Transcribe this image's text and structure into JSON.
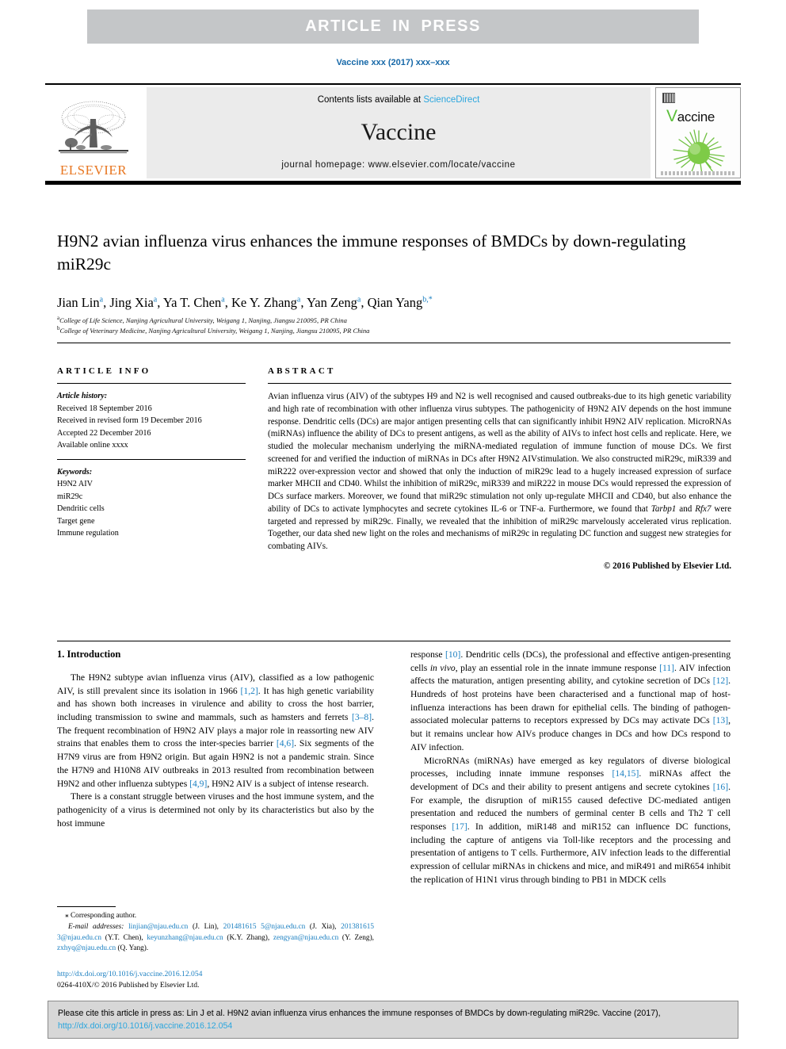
{
  "banner": {
    "text": "ARTICLE IN PRESS"
  },
  "running_head": "Vaccine xxx (2017) xxx–xxx",
  "masthead": {
    "publisher_name": "ELSEVIER",
    "contents_prefix": "Contents lists available at ",
    "contents_link": "ScienceDirect",
    "journal_name": "Vaccine",
    "homepage": "journal homepage: www.elsevier.com/locate/vaccine",
    "cover_title_first": "V",
    "cover_title_rest": "accine"
  },
  "article": {
    "title": "H9N2 avian influenza virus enhances the immune responses of BMDCs by down-regulating miR29c",
    "authors_html": "Jian Lin<sup>a</sup>, Jing Xia<sup>a</sup>, Ya T. Chen<sup>a</sup>, Ke Y. Zhang<sup>a</sup>, Yan Zeng<sup>a</sup>, Qian Yang<sup>b,*</sup>",
    "affiliation_a": "College of Life Science, Nanjing Agricultural University, Weigang 1, Nanjing, Jiangsu 210095, PR China",
    "affiliation_b": "College of Veterinary Medicine, Nanjing Agricultural University, Weigang 1, Nanjing, Jiangsu 210095, PR China"
  },
  "article_info": {
    "heading": "ARTICLE INFO",
    "history_label": "Article history:",
    "history": [
      "Received 18 September 2016",
      "Received in revised form 19 December 2016",
      "Accepted 22 December 2016",
      "Available online xxxx"
    ],
    "keywords_label": "Keywords:",
    "keywords": [
      "H9N2 AIV",
      "miR29c",
      "Dendritic cells",
      "Target gene",
      "Immune regulation"
    ]
  },
  "abstract": {
    "heading": "ABSTRACT",
    "body_html": "Avian influenza virus (AIV) of the subtypes H9 and N2 is well recognised and caused outbreaks-due to its high genetic variability and high rate of recombination with other influenza virus subtypes. The pathogenicity of H9N2 AIV depends on the host immune response. Dendritic cells (DCs) are major antigen presenting cells that can significantly inhibit H9N2 AIV replication. MicroRNAs (miRNAs) influence the ability of DCs to present antigens, as well as the ability of AIVs to infect host cells and replicate. Here, we studied the molecular mechanism underlying the miRNA-mediated regulation of immune function of mouse DCs. We first screened for and verified the induction of miRNAs in DCs after H9N2 AIVstimulation. We also constructed miR29c, miR339 and miR222 over-expression vector and showed that only the induction of miR29c lead to a hugely increased expression of surface marker MHCII and CD40. Whilst the inhibition of miR29c, miR339 and miR222 in mouse DCs would repressed the expression of DCs surface markers. Moreover, we found that miR29c stimulation not only up-regulate MHCII and CD40, but also enhance the ability of DCs to activate lymphocytes and secrete cytokines IL-6 or TNF-a. Furthermore, we found that <span class=\"gene\">Tarbp1</span> and <span class=\"gene\">Rfx7</span> were targeted and repressed by miR29c. Finally, we revealed that the inhibition of miR29c marvelously accelerated virus replication. Together, our data shed new light on the roles and mechanisms of miR29c in regulating DC function and suggest new strategies for combating AIVs.",
    "copyright": "© 2016 Published by Elsevier Ltd."
  },
  "introduction": {
    "heading": "1. Introduction",
    "left_paragraphs_html": [
      "The H9N2 subtype avian influenza virus (AIV), classified as a low pathogenic AIV, is still prevalent since its isolation in 1966 <span class=\"ref\">[1,2]</span>. It has high genetic variability and has shown both increases in virulence and ability to cross the host barrier, including transmission to swine and mammals, such as hamsters and ferrets <span class=\"ref\">[3–8]</span>. The frequent recombination of H9N2 AIV plays a major role in reassorting new AIV strains that enables them to cross the inter-species barrier <span class=\"ref\">[4,6]</span>. Six segments of the H7N9 virus are from H9N2 origin. But again H9N2 is not a pandemic strain. Since the H7N9 and H10N8 AIV outbreaks in 2013 resulted from recombination between H9N2 and other influenza subtypes <span class=\"ref\">[4,9]</span>, H9N2 AIV is a subject of intense research.",
      "There is a constant struggle between viruses and the host immune system, and the pathogenicity of a virus is determined not only by its characteristics but also by the host immune"
    ],
    "right_paragraphs_html": [
      "response <span class=\"ref\">[10]</span>. Dendritic cells (DCs), the professional and effective antigen-presenting cells <span class=\"ital\">in vivo</span>, play an essential role in the innate immune response <span class=\"ref\">[11]</span>. AIV infection affects the maturation, antigen presenting ability, and cytokine secretion of DCs <span class=\"ref\">[12]</span>. Hundreds of host proteins have been characterised and a functional map of host-influenza interactions has been drawn for epithelial cells. The binding of pathogen-associated molecular patterns to receptors expressed by DCs may activate DCs <span class=\"ref\">[13]</span>, but it remains unclear how AIVs produce changes in DCs and how DCs respond to AIV infection.",
      "MicroRNAs (miRNAs) have emerged as key regulators of diverse biological processes, including innate immune responses <span class=\"ref\">[14,15]</span>. miRNAs affect the development of DCs and their ability to present antigens and secrete cytokines <span class=\"ref\">[16]</span>. For example, the disruption of miR155 caused defective DC-mediated antigen presentation and reduced the numbers of germinal center B cells and Th2 T cell responses <span class=\"ref\">[17]</span>. In addition, miR148 and miR152 can influence DC functions, including the capture of antigens via Toll-like receptors and the processing and presentation of antigens to T cells. Furthermore, AIV infection leads to the differential expression of cellular miRNAs in chickens and mice, and miR491 and miR654 inhibit the replication of H1N1 virus through binding to PB1 in MDCK cells"
    ]
  },
  "footnote": {
    "corresponding": "⁎ Corresponding author.",
    "email_label": "E-mail addresses:",
    "emails_html": "<span class=\"mail\">linjian@njau.edu.cn</span> (J. Lin), <span class=\"mail\">201481615 5@njau.edu.cn</span> (J. Xia), <span class=\"mail\">201381615 3@njau.edu.cn</span> (Y.T. Chen), <span class=\"mail\">keyunzhang@njau.edu.cn</span> (K.Y. Zhang), <span class=\"mail\">zengyan@njau.edu.cn</span> (Y. Zeng), <span class=\"mail\">zxhyq@njau.edu.cn</span> (Q. Yang).",
    "doi_url": "http://dx.doi.org/10.1016/j.vaccine.2016.12.054",
    "issn_line": "0264-410X/© 2016 Published by Elsevier Ltd."
  },
  "citation_box": {
    "text_before": "Please cite this article in press as: Lin J et al. H9N2 avian influenza virus enhances the immune responses of BMDCs by down-regulating miR29c. Vaccine (2017), ",
    "link": "http://dx.doi.org/10.1016/j.vaccine.2016.12.054"
  },
  "colors": {
    "banner_bg": "#c4c6c8",
    "link_blue": "#1a7fc1",
    "science_direct_blue": "#2ba6de",
    "elsevier_orange": "#e87722",
    "masthead_bg": "#ebebeb",
    "cite_box_bg": "#d7d7d7",
    "cover_green": "#5bbf3a"
  }
}
